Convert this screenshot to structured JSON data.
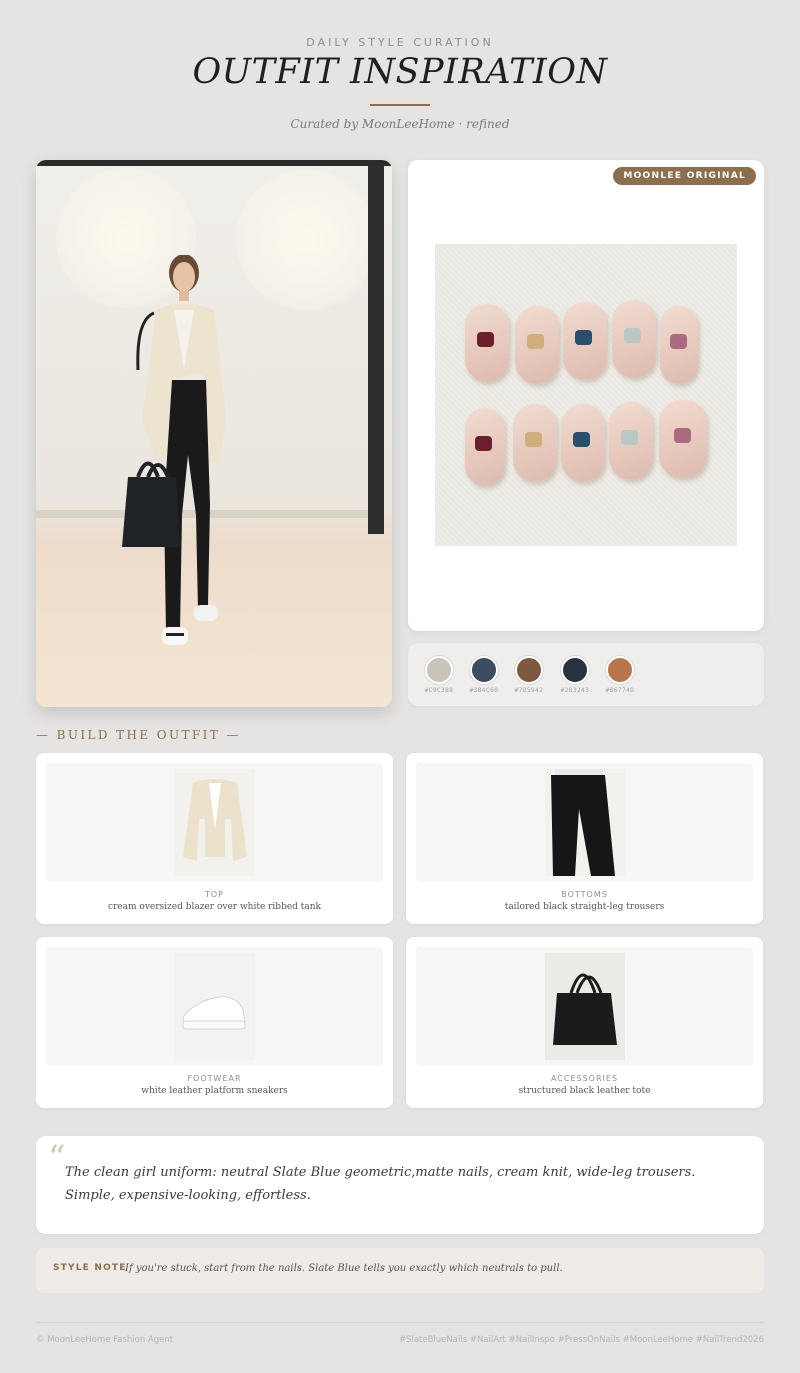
{
  "header": {
    "eyebrow": "DAILY STYLE CURATION",
    "title": "OUTFIT INSPIRATION",
    "subtitle": "Curated by MoonLeeHome · refined"
  },
  "nail_card": {
    "badge": "MOONLEE ORIGINAL"
  },
  "palette": [
    {
      "hex": "#C9C3B8",
      "label": "#C9C3B8"
    },
    {
      "hex": "#3B4C60",
      "label": "#3B4C60"
    },
    {
      "hex": "#7D5942",
      "label": "#7D5942"
    },
    {
      "hex": "#283243",
      "label": "#283243"
    },
    {
      "hex": "#B6774D",
      "label": "#B6774D"
    }
  ],
  "section_label": "— BUILD THE OUTFIT —",
  "pieces": [
    {
      "category": "TOP",
      "description": "cream oversized blazer over white ribbed tank"
    },
    {
      "category": "BOTTOMS",
      "description": "tailored black straight-leg trousers"
    },
    {
      "category": "FOOTWEAR",
      "description": "white leather platform sneakers"
    },
    {
      "category": "ACCESSORIES",
      "description": "structured black leather tote"
    }
  ],
  "quote": {
    "mark": "“",
    "text": "The clean girl uniform: neutral Slate Blue geometric,matte nails, cream knit, wide-leg trousers. Simple, expensive-looking, effortless."
  },
  "style_note": {
    "label": "STYLE NOTE",
    "text": "If you're stuck, start from the nails. Slate Blue tells you exactly which neutrals to pull."
  },
  "footer": {
    "left": "© MoonLeeHome Fashion Agent",
    "right": "#SlateBlueNails #NailArt #NailInspo #PressOnNails #MoonLeeHome #NailTrend2026"
  },
  "colors": {
    "accent": "#8B6F4E",
    "background": "#E5E4E2"
  }
}
